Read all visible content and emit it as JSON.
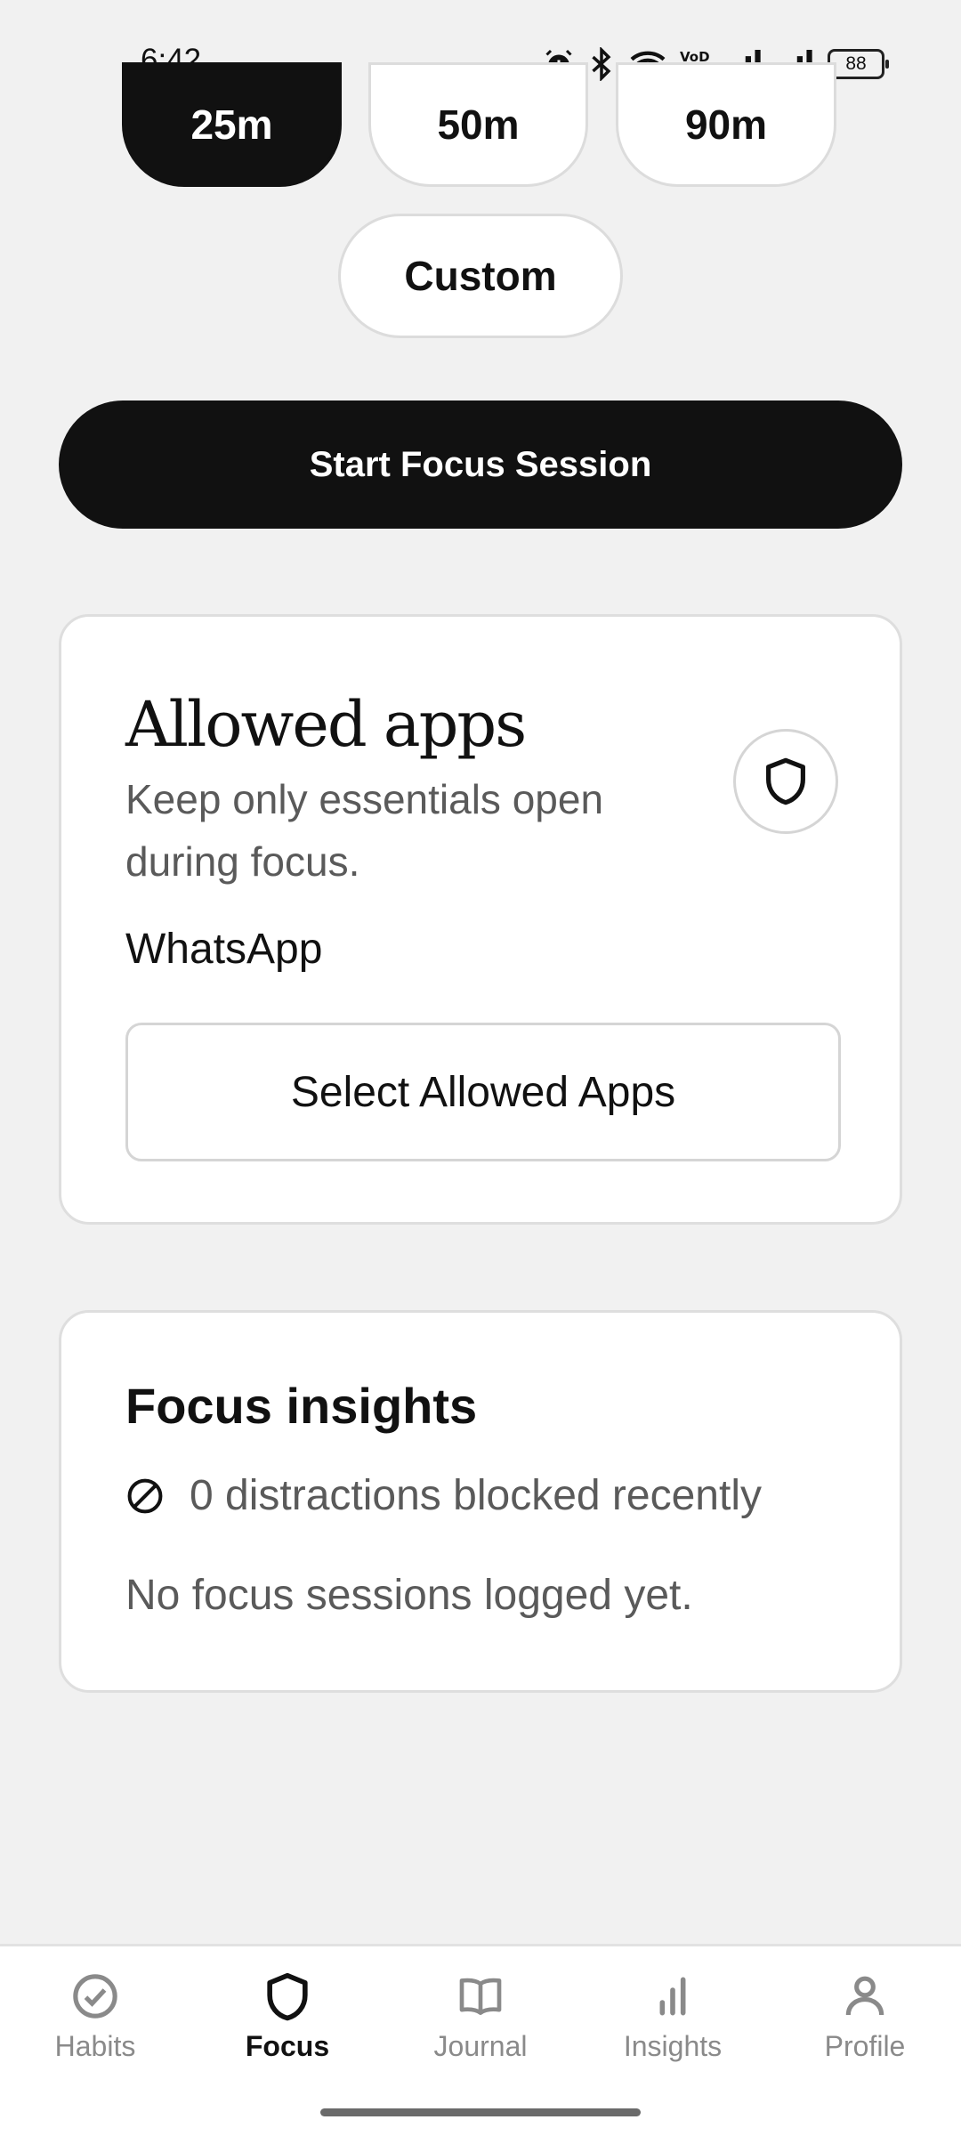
{
  "status_bar": {
    "time": "6:42",
    "battery": "88",
    "icons": [
      "alarm-icon",
      "bluetooth-icon",
      "wifi-icon",
      "volte-icon",
      "signal-icon",
      "signal-icon",
      "battery-icon"
    ]
  },
  "durations": {
    "options": [
      "25m",
      "50m",
      "90m",
      "Custom"
    ],
    "selected": "25m"
  },
  "start_button": {
    "label": "Start Focus Session"
  },
  "allowed_apps": {
    "title": "Allowed apps",
    "subtitle": "Keep only essentials open during focus.",
    "apps": [
      "WhatsApp"
    ],
    "select_button": "Select Allowed Apps",
    "icon": "shield-icon"
  },
  "insights_card": {
    "title": "Focus insights",
    "blocked_text": "0 distractions blocked recently",
    "empty_text": "No focus sessions logged yet.",
    "icon": "block-icon"
  },
  "bottom_nav": {
    "items": [
      {
        "label": "Habits",
        "icon": "check-circle-icon"
      },
      {
        "label": "Focus",
        "icon": "shield-icon"
      },
      {
        "label": "Journal",
        "icon": "book-icon"
      },
      {
        "label": "Insights",
        "icon": "bar-chart-icon"
      },
      {
        "label": "Profile",
        "icon": "person-icon"
      }
    ],
    "active": "Focus"
  },
  "colors": {
    "background": "#f1f1f1",
    "primary": "#111111",
    "card": "#ffffff",
    "muted_text": "#5a5a5a",
    "inactive_nav": "#8a8a8a"
  }
}
